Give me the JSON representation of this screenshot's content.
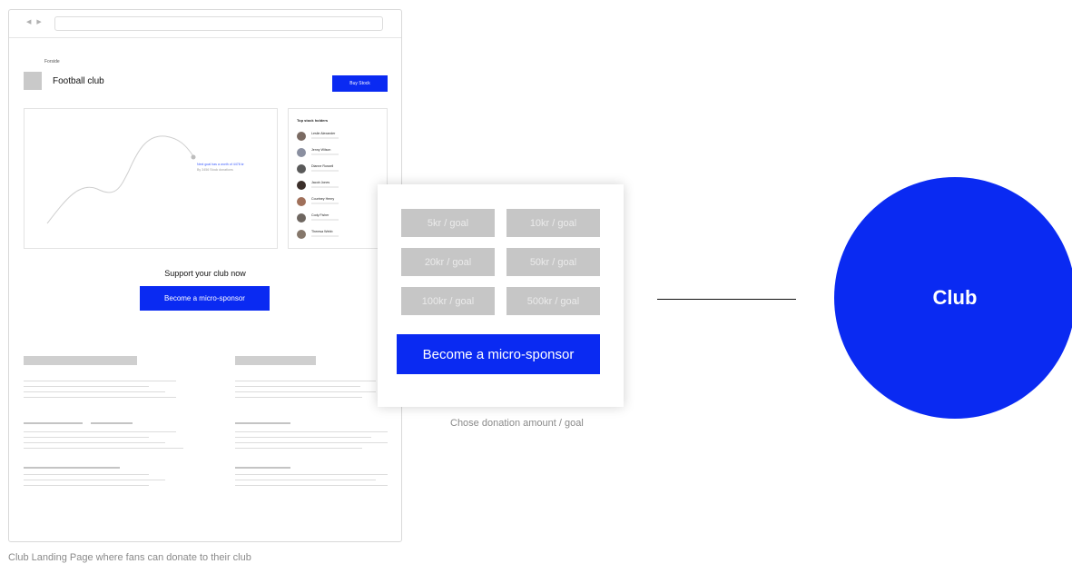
{
  "landing": {
    "breadcrumb": "Forside",
    "club_title": "Football club",
    "buy_button": "Buy Stock",
    "chart_note_title": "Next goal has a worth of 4478 kr",
    "chart_note_sub": "By 3456 Stock donations",
    "holders_title": "Top stock holders",
    "holders": [
      {
        "name": "Leslie Alexander"
      },
      {
        "name": "Jenny Wilson"
      },
      {
        "name": "Dianne Russell"
      },
      {
        "name": "Jacob Jones"
      },
      {
        "name": "Courtney Henry"
      },
      {
        "name": "Cody Fisher"
      },
      {
        "name": "Theresa Webb"
      }
    ],
    "support_text": "Support your club now",
    "sponsor_button": "Become a micro-sponsor",
    "caption": "Club Landing Page where fans can donate to their club"
  },
  "popup": {
    "amounts": [
      "5kr / goal",
      "10kr / goal",
      "20kr / goal",
      "50kr / goal",
      "100kr / goal",
      "500kr / goal"
    ],
    "sponsor_button": "Become a micro-sponsor",
    "caption": "Chose donation amount / goal"
  },
  "club_node": {
    "label": "Club"
  },
  "colors": {
    "accent": "#0a2af2",
    "placeholder": "#c6c6c6"
  }
}
